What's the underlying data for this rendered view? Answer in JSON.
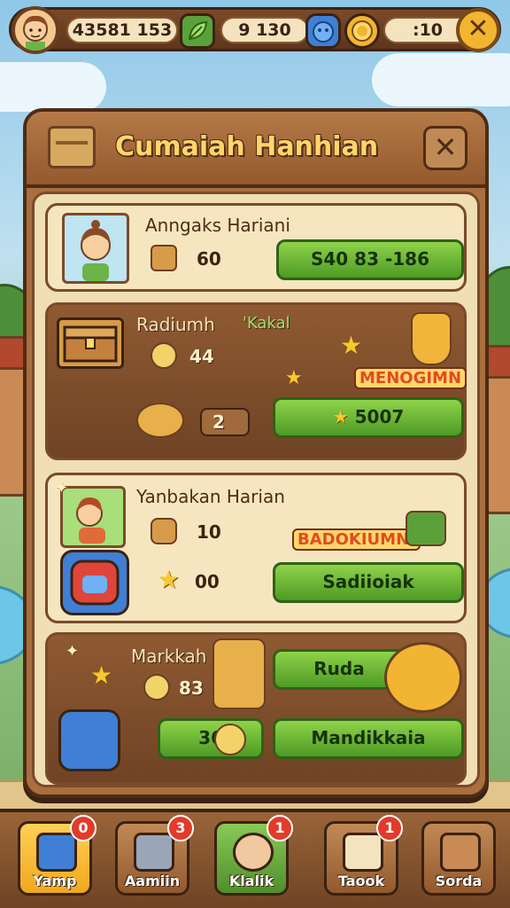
{
  "topbar": {
    "currency_1": "43581 153",
    "currency_2": "9 130",
    "currency_3": ":10"
  },
  "panel": {
    "title": "Cumaiah Hanhian"
  },
  "cards": [
    {
      "title": "Anngaks Hariani",
      "value_1": "60",
      "button_label": "S40 83 -186"
    },
    {
      "title": "Radiumh",
      "tag": "'Kakal",
      "value_1": "44",
      "value_2": "2",
      "badge": "MENOGIMN",
      "button_label": "5007"
    },
    {
      "title": "Yanbakan Harian",
      "value_1": "10",
      "value_2": "00",
      "badge": "BADOKIUMNI",
      "button_label": "Sadiioiak"
    },
    {
      "title": "Markkah",
      "value_1": "83",
      "value_2": "36",
      "button_label_1": "Ruda",
      "button_label_2": "Mandikkaia"
    }
  ],
  "nav": [
    {
      "label": "Yamp",
      "badge": "0"
    },
    {
      "label": "Aamiin",
      "badge": "3"
    },
    {
      "label": "Klalik",
      "badge": "1"
    },
    {
      "label": "Taook",
      "badge": "1"
    },
    {
      "label": "Sorda"
    }
  ],
  "colors": {
    "wood_dark": "#4e2c15",
    "wood": "#a96f3f",
    "parchment": "#f0deb4",
    "button_green": "#4e9b25",
    "gold": "#f2b532",
    "badge_red": "#e23b2a"
  }
}
